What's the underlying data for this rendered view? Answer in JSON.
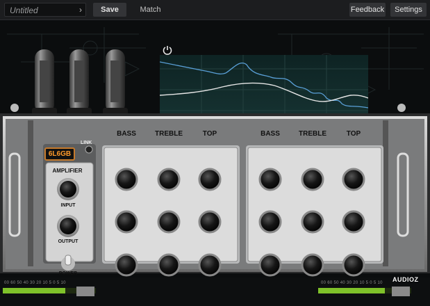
{
  "toolbar": {
    "preset_name": "Untitled",
    "save_label": "Save",
    "match_label": "Match",
    "feedback_label": "Feedback",
    "settings_label": "Settings"
  },
  "amp": {
    "tube_type": "6L6GB",
    "link_label": "LINK",
    "amplifier_label": "AMPLIFIER",
    "input_label": "INPUT",
    "output_label": "OUTPUT",
    "power_label": "POWER"
  },
  "eq_sections": [
    {
      "bass_label": "BASS",
      "treble_label": "TREBLE",
      "top_label": "TOP"
    },
    {
      "bass_label": "BASS",
      "treble_label": "TREBLE",
      "top_label": "TOP"
    }
  ],
  "meters": {
    "left_ticks": "00 60 50 40 30 20 10 5 0 5 10",
    "right_ticks": "00 60 50 40 30 20 10 5 0 5 10"
  },
  "watermark": "AUDIOZ",
  "icons": {
    "preset_menu": "chevron-right-icon",
    "power": "power-icon"
  },
  "colors": {
    "tube_badge_text": "#ff9a2a",
    "curve_blue": "#5aa0d8",
    "meter_green": "#7fc22a"
  }
}
